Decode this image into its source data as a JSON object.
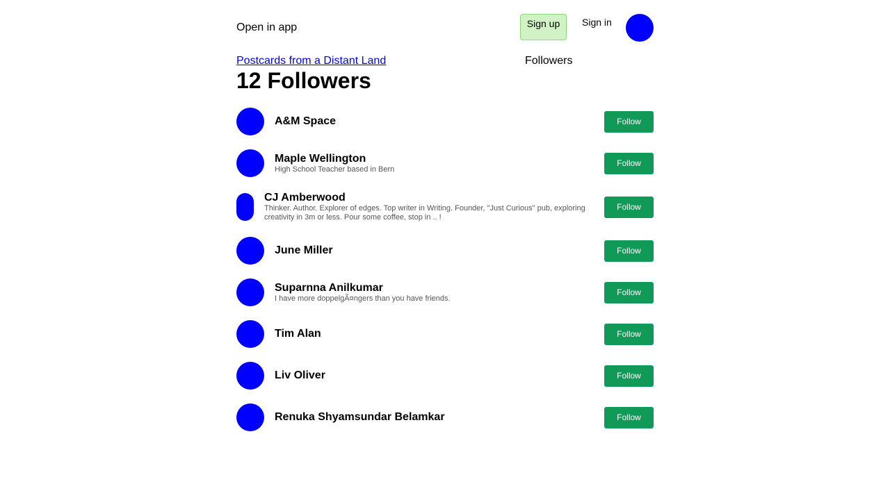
{
  "header": {
    "open_in_app": "Open in app",
    "signup_label": "Sign up",
    "signin_label": "Sign in"
  },
  "breadcrumb": {
    "publication": "Postcards from a Distant Land",
    "current": "Followers"
  },
  "page_title": "12 Followers",
  "followers": [
    {
      "name": "A&M Space",
      "bio": "",
      "follow_label": "Follow"
    },
    {
      "name": "Maple Wellington",
      "bio": "High School Teacher based in Bern",
      "follow_label": "Follow"
    },
    {
      "name": "CJ Amberwood",
      "bio": "Thinker. Author. Explorer of edges. Top writer in Writing. Founder, \"Just Curious\" pub, exploring creativity in 3m or less. Pour some coffee, stop in .. !",
      "follow_label": "Follow"
    },
    {
      "name": "June Miller",
      "bio": "",
      "follow_label": "Follow"
    },
    {
      "name": "Suparnna Anilkumar",
      "bio": "I have more doppelgÃ¤ngers than you have friends.",
      "follow_label": "Follow"
    },
    {
      "name": "Tim Alan",
      "bio": "",
      "follow_label": "Follow"
    },
    {
      "name": "Liv Oliver",
      "bio": "",
      "follow_label": "Follow"
    },
    {
      "name": "Renuka Shyamsundar Belamkar",
      "bio": "",
      "follow_label": "Follow"
    }
  ],
  "colors": {
    "avatar": "#0000ff",
    "follow_button": "#119a57",
    "signup_bg": "#d1f2c4",
    "link": "#0000ee"
  }
}
